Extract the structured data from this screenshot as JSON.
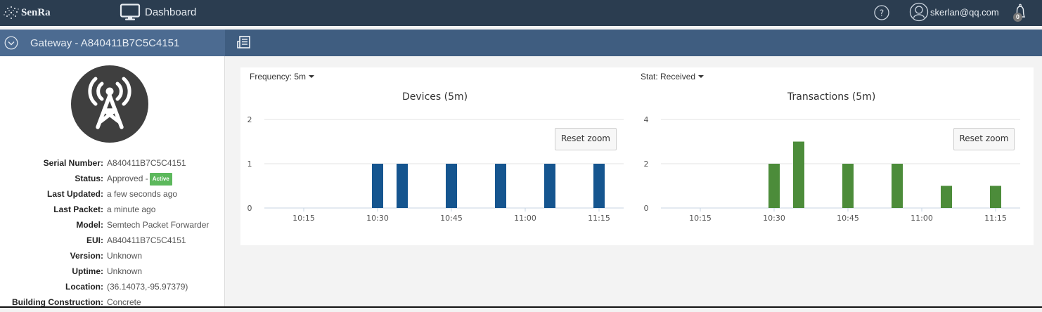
{
  "topbar": {
    "brand": "SenRa",
    "nav_dashboard": "Dashboard",
    "user_email": "skerlan@qq.com",
    "notifications_count": "0",
    "icons": [
      "senra-logo-icon",
      "monitor-icon",
      "help-icon",
      "user-icon",
      "bell-icon"
    ]
  },
  "subbar": {
    "gateway_title": "Gateway - A840411B7C5C4151",
    "icons": [
      "chevron-down-circle-icon",
      "report-icon"
    ]
  },
  "gateway": {
    "icon": "radio-tower-icon",
    "props": [
      {
        "key": "Serial Number:",
        "value": "A840411B7C5C4151"
      },
      {
        "key": "Status:",
        "value": "Approved -",
        "badge": "Active"
      },
      {
        "key": "Last Updated:",
        "value": "a few seconds ago"
      },
      {
        "key": "Last Packet:",
        "value": "a minute ago"
      },
      {
        "key": "Model:",
        "value": "Semtech Packet Forwarder"
      },
      {
        "key": "EUI:",
        "value": "A840411B7C5C4151"
      },
      {
        "key": "Version:",
        "value": "Unknown"
      },
      {
        "key": "Uptime:",
        "value": "Unknown"
      },
      {
        "key": "Location:",
        "value": "(36.14073,-95.97379)"
      },
      {
        "key": "Building Construction:",
        "value": "Concrete"
      }
    ]
  },
  "controls": {
    "frequency": "Frequency: 5m",
    "stat": "Stat: Received",
    "reset_zoom": "Reset zoom"
  },
  "colors": {
    "devices_bar": "#15558f",
    "transactions_bar": "#4c8c3a",
    "active_badge": "#5cb85c"
  },
  "chart_data": [
    {
      "type": "bar",
      "title": "Devices (5m)",
      "x_ticks": [
        "10:15",
        "10:30",
        "10:45",
        "11:00",
        "11:15"
      ],
      "y_ticks": [
        0,
        1,
        2
      ],
      "ylim": [
        0,
        2
      ],
      "categories": [
        "10:30",
        "10:35",
        "10:45",
        "10:55",
        "11:05",
        "11:15"
      ],
      "values": [
        1,
        1,
        1,
        1,
        1,
        1
      ],
      "grid": true
    },
    {
      "type": "bar",
      "title": "Transactions (5m)",
      "x_ticks": [
        "10:15",
        "10:30",
        "10:45",
        "11:00",
        "11:15"
      ],
      "y_ticks": [
        0,
        2,
        4
      ],
      "ylim": [
        0,
        4
      ],
      "categories": [
        "10:30",
        "10:35",
        "10:45",
        "10:55",
        "11:05",
        "11:15"
      ],
      "values": [
        2,
        3,
        2,
        2,
        1,
        1
      ],
      "grid": true
    }
  ]
}
